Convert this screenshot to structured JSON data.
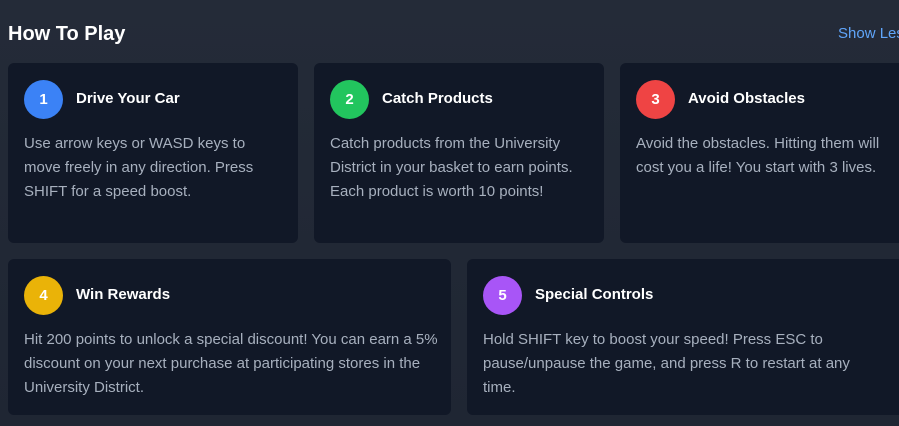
{
  "header": {
    "title": "How To Play",
    "toggle_label": "Show Less"
  },
  "steps": [
    {
      "number": "1",
      "title": "Drive Your Car",
      "description": "Use arrow keys or WASD keys to move freely in any direction. Press SHIFT for a speed boost.",
      "color": "#3b82f6"
    },
    {
      "number": "2",
      "title": "Catch Products",
      "description": "Catch products from the University District in your basket to earn points. Each product is worth 10 points!",
      "color": "#22c55e"
    },
    {
      "number": "3",
      "title": "Avoid Obstacles",
      "description": "Avoid the obstacles. Hitting them will cost you a life! You start with 3 lives.",
      "color": "#ef4444"
    },
    {
      "number": "4",
      "title": "Win Rewards",
      "description": "Hit 200 points to unlock a special discount! You can earn a 5% discount on your next purchase at participating stores in the University District.",
      "color": "#eab308"
    },
    {
      "number": "5",
      "title": "Special Controls",
      "description": "Hold SHIFT key to boost your speed! Press ESC to pause/unpause the game, and press R to restart at any time.",
      "color": "#a855f7"
    }
  ]
}
